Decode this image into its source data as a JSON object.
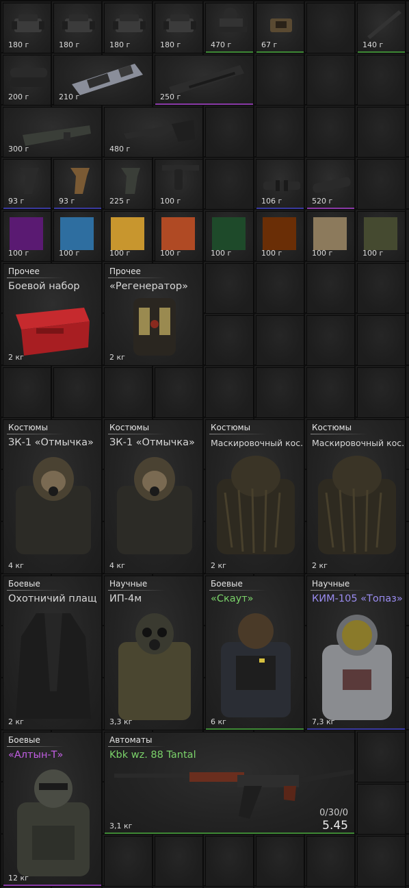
{
  "accessories": {
    "sight1_weight": "180 г",
    "sight2_weight": "180 г",
    "sight3_weight": "180 г",
    "sight4_weight": "180 г",
    "scope_weight": "470 г",
    "reddot_weight": "67 г",
    "rail_weight": "140 г",
    "flashlight_weight": "200 г",
    "wrap_weight": "210 г",
    "handguard_weight": "250 г",
    "stock1_weight": "300 г",
    "stock2_weight": "480 г",
    "grip1_weight": "93 г",
    "grip2_weight": "93 г",
    "grip3_weight": "225 г",
    "vertgrip_weight": "100 г",
    "muzzle1_weight": "106 г",
    "silencer_weight": "520 г"
  },
  "paints": [
    {
      "weight": "100 г",
      "color": "#5a1a72"
    },
    {
      "weight": "100 г",
      "color": "#2e6ea0"
    },
    {
      "weight": "100 г",
      "color": "#c8962e"
    },
    {
      "weight": "100 г",
      "color": "#b04a24"
    },
    {
      "weight": "100 г",
      "color": "#1e4a2a"
    },
    {
      "weight": "100 г",
      "color": "#6a2e06"
    },
    {
      "weight": "100 г",
      "color": "#8c7a5c"
    },
    {
      "weight": "100 г",
      "color": "#454a30"
    }
  ],
  "misc": [
    {
      "category": "Прочее",
      "name": "Боевой набор",
      "weight": "2 кг"
    },
    {
      "category": "Прочее",
      "name": "«Регенератор»",
      "weight": "2 кг"
    }
  ],
  "suits": [
    {
      "category": "Костюмы",
      "name": "ЗК-1 «Отмычка»",
      "weight": "4 кг"
    },
    {
      "category": "Костюмы",
      "name": "ЗК-1 «Отмычка»",
      "weight": "4 кг"
    },
    {
      "category": "Костюмы",
      "name": "Маскировочный кос...",
      "weight": "2 кг"
    },
    {
      "category": "Костюмы",
      "name": "Маскировочный кос...",
      "weight": "2 кг"
    }
  ],
  "armor": [
    {
      "category": "Боевые",
      "name": "Охотничий плащ",
      "weight": "2 кг"
    },
    {
      "category": "Научные",
      "name": "ИП-4м",
      "weight": "3,3 кг"
    },
    {
      "category": "Боевые",
      "name": "«Скаут»",
      "weight": "6 кг"
    },
    {
      "category": "Научные",
      "name": "КИМ-105 «Топаз»",
      "weight": "7,3 кг"
    },
    {
      "category": "Боевые",
      "name": "«Алтын-Т»",
      "weight": "12 кг"
    }
  ],
  "rifle": {
    "category": "Автоматы",
    "name": "Kbk wz. 88 Tantal",
    "weight": "3,1 кг",
    "ammo": "0/30/0",
    "caliber": "5.45"
  },
  "colors": {
    "green": "#7bd36a",
    "purple": "#c45fe6",
    "blue": "#9a8cf0",
    "rarity_green": "#3f8a36",
    "rarity_purple": "#8a3aa8",
    "rarity_blue": "#3a3aa0"
  }
}
